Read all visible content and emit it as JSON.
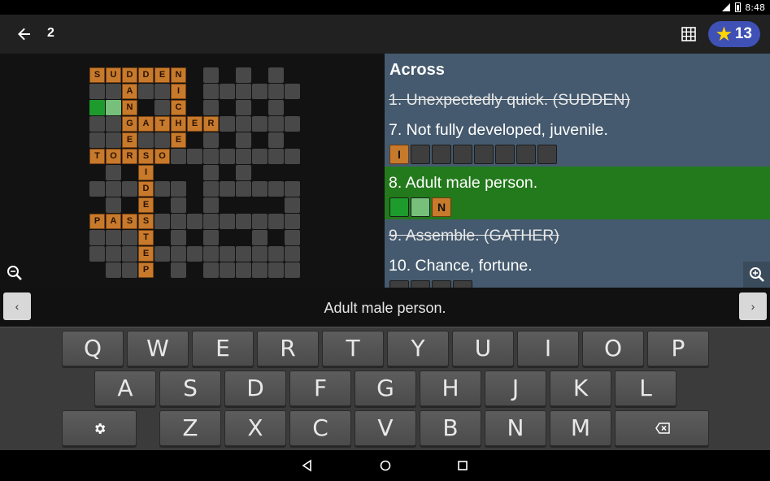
{
  "status": {
    "time": "8:48",
    "battery_icon": "battery-icon",
    "signal_icon": "signal-icon"
  },
  "toolbar": {
    "back_icon": "back-arrow-icon",
    "puzzle_number": "2",
    "grid_icon": "grid-icon",
    "stars": "13",
    "star_icon": "star-icon"
  },
  "clues": {
    "section_title": "Across",
    "items": [
      {
        "text": "1. Unexpectedly quick. (SUDDEN)",
        "solved": true
      },
      {
        "text": "7. Not fully developed, juvenile.",
        "solved": false,
        "boxes": [
          "I",
          "",
          "",
          "",
          "",
          "",
          "",
          ""
        ]
      },
      {
        "text": "8. Adult male person.",
        "solved": false,
        "selected": true,
        "boxes": [
          "",
          "",
          "N"
        ]
      },
      {
        "text": "9. Assemble. (GATHER)",
        "solved": true
      },
      {
        "text": "10. Chance, fortune.",
        "solved": false,
        "boxes": [
          "",
          "",
          "",
          ""
        ]
      }
    ]
  },
  "cluebar": {
    "prev": "‹",
    "text": "Adult male person.",
    "next": "›"
  },
  "keyboard": {
    "row1": [
      "Q",
      "W",
      "E",
      "R",
      "T",
      "Y",
      "U",
      "I",
      "O",
      "P"
    ],
    "row2": [
      "A",
      "S",
      "D",
      "F",
      "G",
      "H",
      "J",
      "K",
      "L"
    ],
    "row3": [
      "Z",
      "X",
      "C",
      "V",
      "B",
      "N",
      "M"
    ],
    "settings_icon": "gear-icon",
    "backspace_icon": "backspace-icon"
  },
  "navbar": {
    "back": "nav-back-icon",
    "home": "nav-home-icon",
    "recents": "nav-recents-icon"
  },
  "grid": {
    "letters": [
      [
        "S",
        0,
        0
      ],
      [
        "U",
        1,
        0
      ],
      [
        "D",
        2,
        0
      ],
      [
        "D",
        3,
        0
      ],
      [
        "E",
        4,
        0
      ],
      [
        "N",
        5,
        0
      ],
      [
        "A",
        2,
        1
      ],
      [
        "I",
        5,
        1
      ],
      [
        "N",
        2,
        2
      ],
      [
        "C",
        5,
        2
      ],
      [
        "G",
        2,
        3
      ],
      [
        "A",
        3,
        3
      ],
      [
        "T",
        4,
        3
      ],
      [
        "H",
        5,
        3
      ],
      [
        "E",
        6,
        3
      ],
      [
        "R",
        7,
        3
      ],
      [
        "E",
        2,
        4
      ],
      [
        "E",
        5,
        4
      ],
      [
        "T",
        0,
        5
      ],
      [
        "O",
        1,
        5
      ],
      [
        "R",
        2,
        5
      ],
      [
        "S",
        3,
        5
      ],
      [
        "O",
        4,
        5
      ],
      [
        "I",
        3,
        6
      ],
      [
        "D",
        3,
        7
      ],
      [
        "E",
        3,
        8
      ],
      [
        "P",
        0,
        9
      ],
      [
        "A",
        1,
        9
      ],
      [
        "S",
        2,
        9
      ],
      [
        "S",
        3,
        9
      ],
      [
        "T",
        3,
        10
      ],
      [
        "E",
        3,
        11
      ],
      [
        "P",
        3,
        12
      ]
    ],
    "highlight": [
      [
        "dark",
        0,
        2
      ],
      [
        "light",
        1,
        2
      ]
    ],
    "blanks": [
      [
        7,
        0
      ],
      [
        9,
        0
      ],
      [
        11,
        0
      ],
      [
        0,
        1
      ],
      [
        1,
        1
      ],
      [
        3,
        1
      ],
      [
        4,
        1
      ],
      [
        7,
        1
      ],
      [
        8,
        1
      ],
      [
        9,
        1
      ],
      [
        10,
        1
      ],
      [
        11,
        1
      ],
      [
        12,
        1
      ],
      [
        4,
        2
      ],
      [
        7,
        2
      ],
      [
        9,
        2
      ],
      [
        11,
        2
      ],
      [
        0,
        3
      ],
      [
        1,
        3
      ],
      [
        8,
        3
      ],
      [
        9,
        3
      ],
      [
        10,
        3
      ],
      [
        11,
        3
      ],
      [
        12,
        3
      ],
      [
        0,
        4
      ],
      [
        1,
        4
      ],
      [
        3,
        4
      ],
      [
        4,
        4
      ],
      [
        7,
        4
      ],
      [
        9,
        4
      ],
      [
        11,
        4
      ],
      [
        5,
        5
      ],
      [
        6,
        5
      ],
      [
        7,
        5
      ],
      [
        8,
        5
      ],
      [
        9,
        5
      ],
      [
        10,
        5
      ],
      [
        11,
        5
      ],
      [
        12,
        5
      ],
      [
        1,
        6
      ],
      [
        7,
        6
      ],
      [
        9,
        6
      ],
      [
        0,
        7
      ],
      [
        1,
        7
      ],
      [
        2,
        7
      ],
      [
        4,
        7
      ],
      [
        5,
        7
      ],
      [
        7,
        7
      ],
      [
        8,
        7
      ],
      [
        9,
        7
      ],
      [
        10,
        7
      ],
      [
        11,
        7
      ],
      [
        12,
        7
      ],
      [
        1,
        8
      ],
      [
        5,
        8
      ],
      [
        7,
        8
      ],
      [
        12,
        8
      ],
      [
        4,
        9
      ],
      [
        5,
        9
      ],
      [
        6,
        9
      ],
      [
        7,
        9
      ],
      [
        8,
        9
      ],
      [
        9,
        9
      ],
      [
        10,
        9
      ],
      [
        11,
        9
      ],
      [
        12,
        9
      ],
      [
        0,
        10
      ],
      [
        1,
        10
      ],
      [
        2,
        10
      ],
      [
        5,
        10
      ],
      [
        7,
        10
      ],
      [
        10,
        10
      ],
      [
        12,
        10
      ],
      [
        0,
        11
      ],
      [
        1,
        11
      ],
      [
        2,
        11
      ],
      [
        4,
        11
      ],
      [
        5,
        11
      ],
      [
        6,
        11
      ],
      [
        7,
        11
      ],
      [
        8,
        11
      ],
      [
        9,
        11
      ],
      [
        10,
        11
      ],
      [
        11,
        11
      ],
      [
        12,
        11
      ],
      [
        1,
        12
      ],
      [
        2,
        12
      ],
      [
        5,
        12
      ],
      [
        7,
        12
      ],
      [
        8,
        12
      ],
      [
        9,
        12
      ],
      [
        10,
        12
      ],
      [
        11,
        12
      ],
      [
        12,
        12
      ]
    ]
  }
}
